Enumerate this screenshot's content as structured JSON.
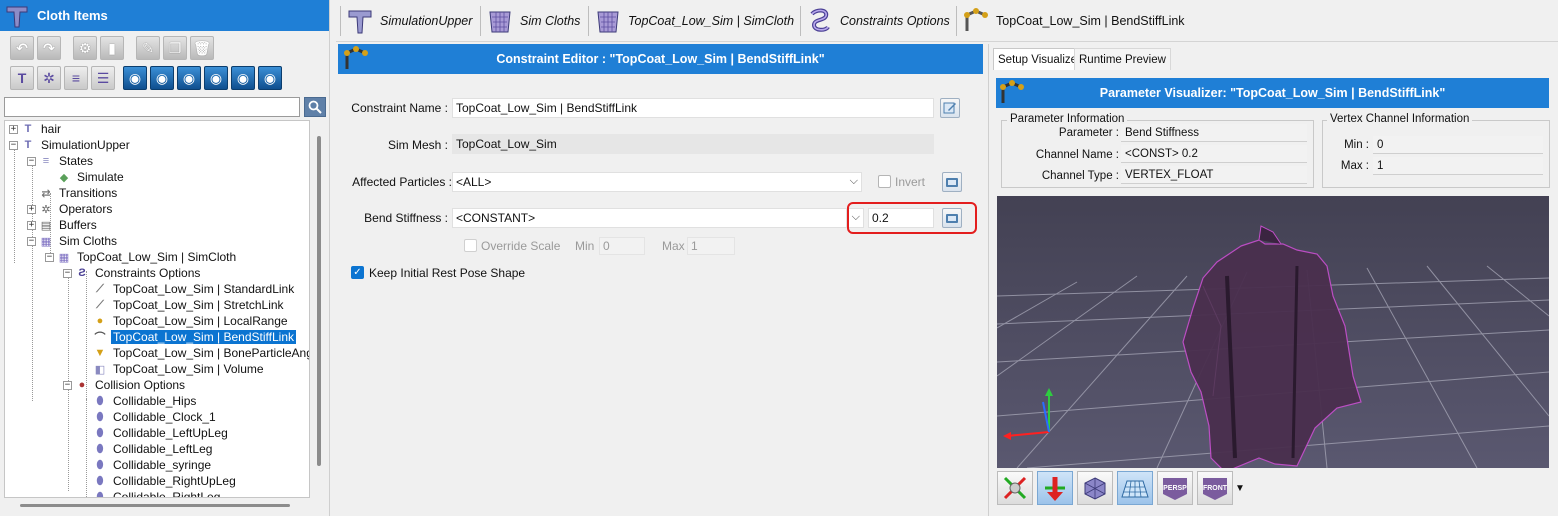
{
  "left_panel": {
    "title": "Cloth Items",
    "search": {
      "value": "",
      "placeholder": ""
    },
    "toolbar_row1": [
      "undo-icon",
      "redo-icon",
      "settings-icon",
      "document-icon",
      "edit-icon",
      "copy-icon",
      "delete-icon"
    ],
    "toolbar_row2": [
      "figure-icon",
      "gear-figure-icon",
      "stack-figure-icon",
      "list-add-icon",
      "eye-grid-icon",
      "eye-figure-icon",
      "eye-solid-icon",
      "eye-cloth-icon",
      "eye-pin-icon",
      "eye-figure2-icon"
    ],
    "tree": [
      {
        "label": "hair",
        "depth": 0,
        "expander": "+",
        "icon": "figure-icon"
      },
      {
        "label": "SimulationUpper",
        "depth": 0,
        "expander": "-",
        "icon": "figure-icon"
      },
      {
        "label": "States",
        "depth": 1,
        "expander": "-",
        "icon": "states-icon"
      },
      {
        "label": "Simulate",
        "depth": 2,
        "expander": "",
        "icon": "simulate-icon"
      },
      {
        "label": "Transitions",
        "depth": 1,
        "expander": "",
        "icon": "transitions-icon"
      },
      {
        "label": "Operators",
        "depth": 1,
        "expander": "+",
        "icon": "operators-icon"
      },
      {
        "label": "Buffers",
        "depth": 1,
        "expander": "+",
        "icon": "buffers-icon"
      },
      {
        "label": "Sim Cloths",
        "depth": 1,
        "expander": "-",
        "icon": "sim-cloths-icon"
      },
      {
        "label": "TopCoat_Low_Sim | SimCloth",
        "depth": 2,
        "expander": "-",
        "icon": "cloth-icon"
      },
      {
        "label": "Constraints Options",
        "depth": 3,
        "expander": "-",
        "icon": "constraints-icon"
      },
      {
        "label": "TopCoat_Low_Sim | StandardLink",
        "depth": 4,
        "expander": "",
        "icon": "standard-link-icon"
      },
      {
        "label": "TopCoat_Low_Sim | StretchLink",
        "depth": 4,
        "expander": "",
        "icon": "stretch-link-icon"
      },
      {
        "label": "TopCoat_Low_Sim | LocalRange",
        "depth": 4,
        "expander": "",
        "icon": "local-range-icon"
      },
      {
        "label": "TopCoat_Low_Sim | BendStiffLink",
        "depth": 4,
        "expander": "",
        "icon": "bend-stiff-icon",
        "selected": true
      },
      {
        "label": "TopCoat_Low_Sim | BoneParticleAngl",
        "depth": 4,
        "expander": "",
        "icon": "bone-particle-icon"
      },
      {
        "label": "TopCoat_Low_Sim | Volume",
        "depth": 4,
        "expander": "",
        "icon": "volume-icon"
      },
      {
        "label": "Collision Options",
        "depth": 3,
        "expander": "-",
        "icon": "collision-icon"
      },
      {
        "label": "Collidable_Hips",
        "depth": 4,
        "expander": "",
        "icon": "collidable-icon"
      },
      {
        "label": "Collidable_Clock_1",
        "depth": 4,
        "expander": "",
        "icon": "collidable-icon"
      },
      {
        "label": "Collidable_LeftUpLeg",
        "depth": 4,
        "expander": "",
        "icon": "collidable-icon"
      },
      {
        "label": "Collidable_LeftLeg",
        "depth": 4,
        "expander": "",
        "icon": "collidable-icon"
      },
      {
        "label": "Collidable_syringe",
        "depth": 4,
        "expander": "",
        "icon": "collidable-icon"
      },
      {
        "label": "Collidable_RightUpLeg",
        "depth": 4,
        "expander": "",
        "icon": "collidable-icon"
      },
      {
        "label": "Collidable_RightLeg",
        "depth": 4,
        "expander": "",
        "icon": "collidable-icon"
      }
    ]
  },
  "top_tabs": [
    {
      "label": "SimulationUpper",
      "icon": "figure-icon"
    },
    {
      "label": "Sim Cloths",
      "icon": "sim-cloths-icon"
    },
    {
      "label": "TopCoat_Low_Sim | SimCloth",
      "icon": "cloth-icon"
    },
    {
      "label": "Constraints Options",
      "icon": "constraints-icon"
    },
    {
      "label": "TopCoat_Low_Sim | BendStiffLink",
      "icon": "bend-stiff-icon"
    }
  ],
  "editor": {
    "title": "Constraint Editor : \"TopCoat_Low_Sim | BendStiffLink\"",
    "constraint_name_label": "Constraint Name :",
    "constraint_name_value": "TopCoat_Low_Sim | BendStiffLink",
    "sim_mesh_label": "Sim Mesh :",
    "sim_mesh_value": "TopCoat_Low_Sim",
    "affected_particles_label": "Affected Particles :",
    "affected_particles_value": "<ALL>",
    "invert_label": "Invert",
    "bend_stiffness_label": "Bend Stiffness :",
    "bend_stiffness_mode": "<CONSTANT>",
    "bend_stiffness_value": "0.2",
    "override_scale_label": "Override Scale",
    "min_label": "Min",
    "min_value": "0",
    "max_label": "Max",
    "max_value": "1",
    "keep_rest_pose_label": "Keep Initial Rest Pose Shape",
    "keep_rest_pose_checked": true
  },
  "visualizer": {
    "tabs": [
      "Setup Visualizer",
      "Runtime Preview"
    ],
    "active_tab": "Setup Visualizer",
    "title": "Parameter Visualizer: \"TopCoat_Low_Sim | BendStiffLink\"",
    "param_info": {
      "group_title": "Parameter Information",
      "parameter_label": "Parameter :",
      "parameter_value": "Bend Stiffness",
      "channel_name_label": "Channel Name :",
      "channel_name_value": "<CONST> 0.2",
      "channel_type_label": "Channel Type :",
      "channel_type_value": "VERTEX_FLOAT"
    },
    "vertex_info": {
      "group_title": "Vertex Channel Information",
      "min_label": "Min :",
      "min_value": "0",
      "max_label": "Max :",
      "max_value": "1"
    },
    "bottom_tools": [
      {
        "icon": "transform-tool-icon",
        "label": ""
      },
      {
        "icon": "move-down-icon",
        "label": ""
      },
      {
        "icon": "mesh-cube-icon",
        "label": ""
      },
      {
        "icon": "grid-floor-icon",
        "label": ""
      },
      {
        "icon": "persp-view-icon",
        "label": "PERSP"
      },
      {
        "icon": "front-view-icon",
        "label": "FRONT"
      }
    ]
  },
  "colors": {
    "header_blue": "#1f7fd6",
    "selection_blue": "#0b74d1",
    "highlight_red": "#e31e1e",
    "viewport_bg": "#4c4a62",
    "cloth": "#4a2f4e"
  }
}
